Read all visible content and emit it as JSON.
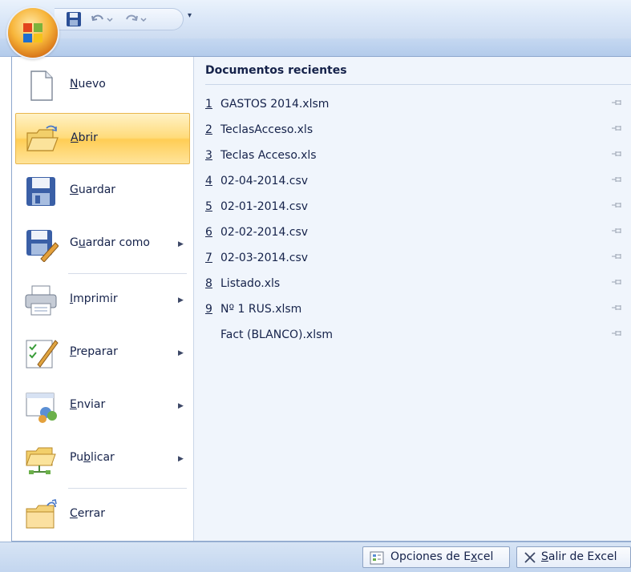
{
  "menu": {
    "items": [
      {
        "label": "Nuevo",
        "u": "N",
        "rest": "uevo",
        "submenu": false,
        "icon": "new-document-icon"
      },
      {
        "label": "Abrir",
        "u": "A",
        "rest": "brir",
        "submenu": false,
        "icon": "open-folder-icon"
      },
      {
        "label": "Guardar",
        "u": "G",
        "rest": "uardar",
        "submenu": false,
        "icon": "save-icon"
      },
      {
        "label": "Guardar como",
        "pre": "G",
        "u": "u",
        "rest": "ardar como",
        "submenu": true,
        "icon": "save-as-icon"
      },
      {
        "label": "Imprimir",
        "u": "I",
        "rest": "mprimir",
        "submenu": true,
        "icon": "print-icon"
      },
      {
        "label": "Preparar",
        "u": "P",
        "rest": "reparar",
        "submenu": true,
        "icon": "prepare-icon"
      },
      {
        "label": "Enviar",
        "u": "E",
        "rest": "nviar",
        "submenu": true,
        "icon": "send-icon"
      },
      {
        "label": "Publicar",
        "pre": "Pu",
        "u": "b",
        "rest": "licar",
        "submenu": true,
        "icon": "publish-icon"
      },
      {
        "label": "Cerrar",
        "u": "C",
        "rest": "errar",
        "submenu": false,
        "icon": "close-folder-icon"
      }
    ],
    "active": "Abrir"
  },
  "recent": {
    "title": "Documentos recientes",
    "documents": [
      {
        "num": "1",
        "name": "GASTOS 2014.xlsm"
      },
      {
        "num": "2",
        "name": "TeclasAcceso.xls"
      },
      {
        "num": "3",
        "name": "Teclas Acceso.xls"
      },
      {
        "num": "4",
        "name": "02-04-2014.csv"
      },
      {
        "num": "5",
        "name": "02-01-2014.csv"
      },
      {
        "num": "6",
        "name": "02-02-2014.csv"
      },
      {
        "num": "7",
        "name": "02-03-2014.csv"
      },
      {
        "num": "8",
        "name": "Listado.xls"
      },
      {
        "num": "9",
        "name": "Nº 1 RUS.xlsm"
      },
      {
        "num": "",
        "name": "Fact (BLANCO).xlsm"
      }
    ]
  },
  "footer": {
    "options": {
      "pre": "Opciones de E",
      "u": "x",
      "rest": "cel"
    },
    "exit": {
      "pre": "",
      "u": "S",
      "rest": "alir de Excel"
    }
  },
  "colors": {
    "accent_active": "#ffdb7a",
    "office_orb": "#f7b53a",
    "frame_blue": "#c5d8f1"
  }
}
